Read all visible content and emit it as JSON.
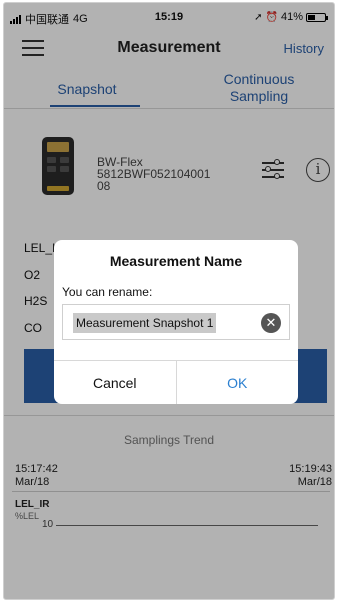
{
  "status_bar": {
    "carrier": "中国联通",
    "network": "4G",
    "time": "15:19",
    "battery_percent": "41%",
    "battery_level": 0.41
  },
  "header": {
    "title": "Measurement",
    "history_label": "History",
    "menu_icon": "hamburger-menu-icon"
  },
  "tabs": {
    "snapshot": "Snapshot",
    "continuous_line1": "Continuous",
    "continuous_line2": "Sampling"
  },
  "device": {
    "name": "BW-Flex",
    "serial_line1": "5812BWF052104001",
    "serial_line2": "08",
    "settings_icon": "sliders-icon",
    "info_icon": "info-icon"
  },
  "gases": [
    {
      "label": "LEL_IR"
    },
    {
      "label": "O2"
    },
    {
      "label": "H2S"
    },
    {
      "label": "CO"
    }
  ],
  "trend": {
    "title": "Samplings Trend",
    "start_time": "15:17:42",
    "start_date": "Mar/18",
    "end_time": "15:19:43",
    "end_date": "Mar/18",
    "series_label": "LEL_IR",
    "series_unit": "%LEL",
    "y_tick": "10"
  },
  "dialog": {
    "title": "Measurement Name",
    "prompt": "You can rename:",
    "input_value": "Measurement Snapshot 1",
    "clear_icon": "clear-icon",
    "cancel_label": "Cancel",
    "ok_label": "OK"
  },
  "colors": {
    "accent": "#2a5fa8",
    "ok": "#2a7fd0"
  }
}
